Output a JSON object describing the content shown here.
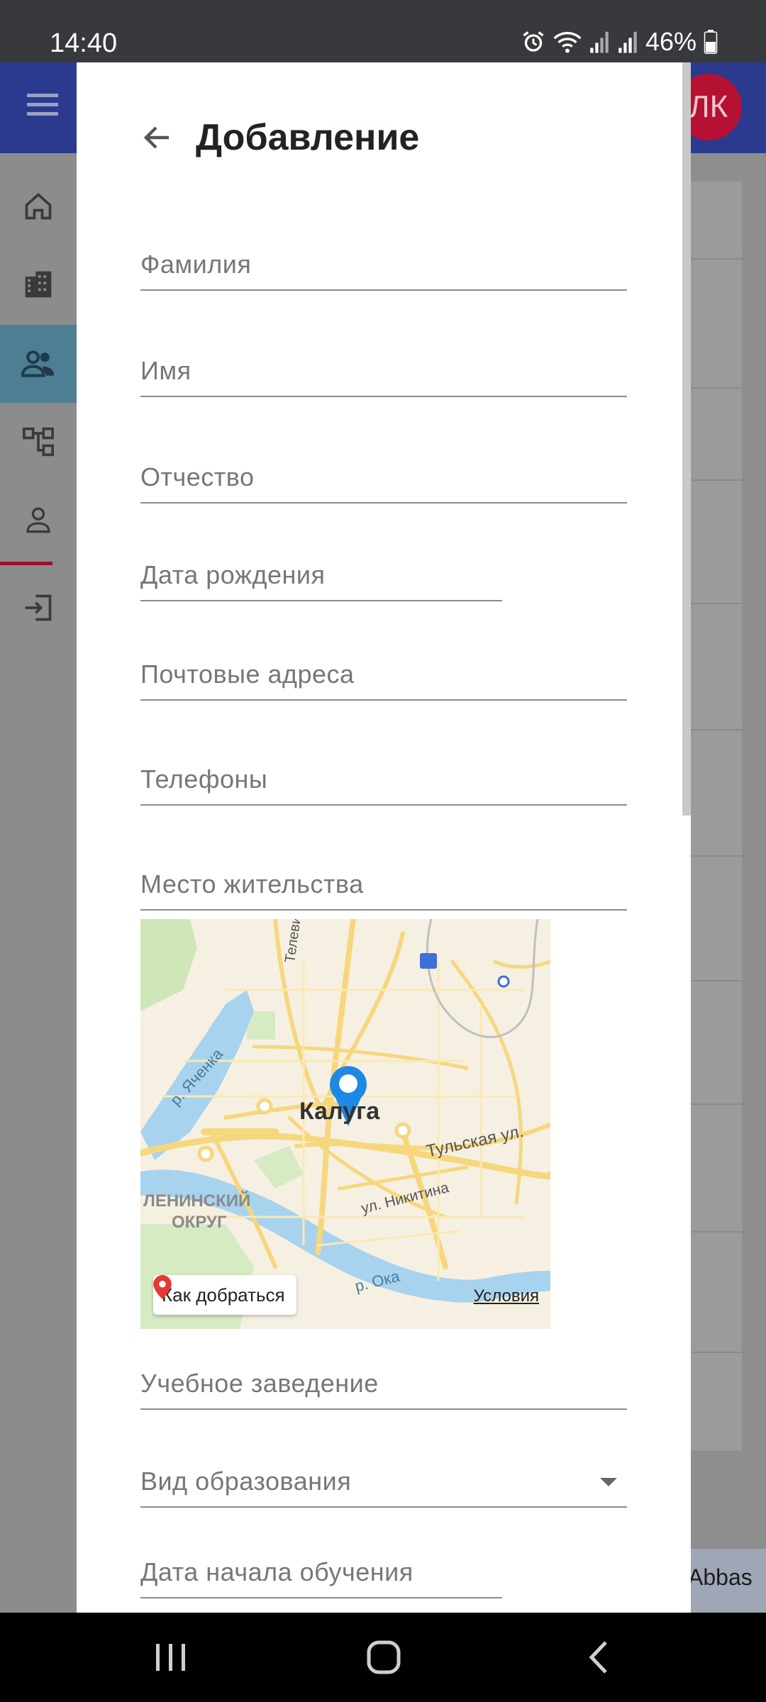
{
  "status_bar": {
    "time": "14:40",
    "battery": "46%"
  },
  "app_bar": {
    "avatar_initials": "ЛК"
  },
  "background": {
    "bottom_text": "Abbas"
  },
  "dialog": {
    "title": "Добавление",
    "fields": {
      "surname": "Фамилия",
      "name": "Имя",
      "patronymic": "Отчество",
      "birth_date": "Дата рождения",
      "postal_addresses": "Почтовые адреса",
      "phones": "Телефоны",
      "residence": "Место жительства",
      "school": "Учебное заведение",
      "education_type": "Вид образования",
      "study_start_date": "Дата начала обучения"
    },
    "map": {
      "city_label": "Калуга",
      "labels": {
        "river_yachenka": "р. Яченка",
        "street_televizionnaya": "Телевизионная ул.",
        "street_tulskaya": "Тульская ул.",
        "street_nikitina": "ул. Никитина",
        "district_line1": "ЛЕНИНСКИЙ",
        "district_line2": "ОКРУГ",
        "river_oka": "р. Ока"
      },
      "route_button": "Как добраться",
      "terms_link": "Условия"
    }
  },
  "colors": {
    "app_bar": "#2b3a8f",
    "avatar": "#b51233",
    "active_nav": "#4d7e94",
    "map_pin": "#1e88e5"
  },
  "icons": {
    "menu": "hamburger-icon",
    "back": "arrow-left-icon",
    "pin": "map-pin-icon"
  }
}
